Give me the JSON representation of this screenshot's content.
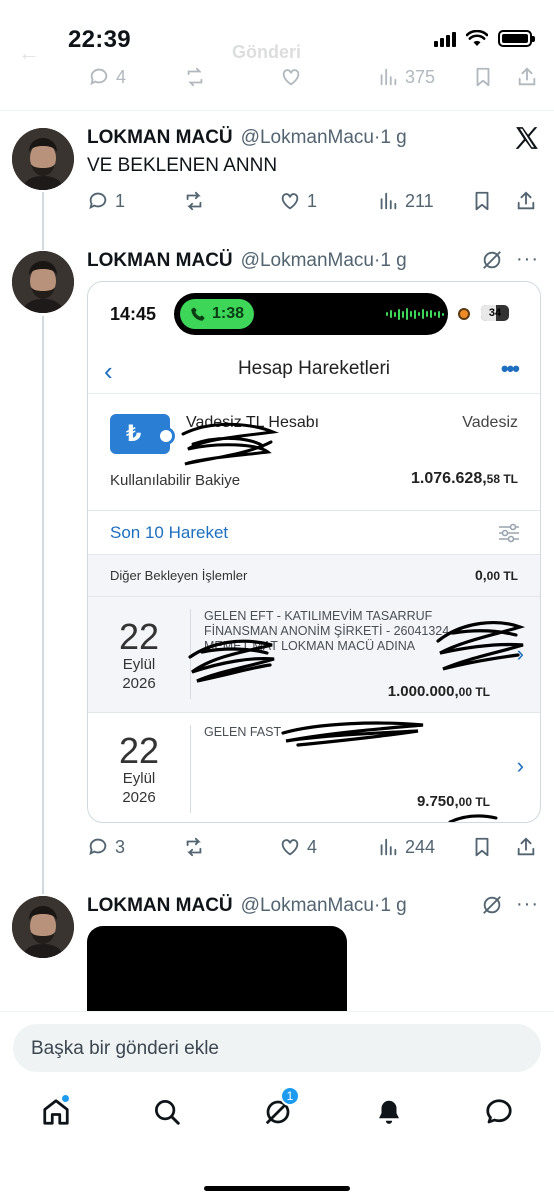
{
  "status_bar": {
    "time": "22:39"
  },
  "header": {
    "title": "Gönderi"
  },
  "top_row": {
    "replies": "4",
    "views": "375"
  },
  "tweets": [
    {
      "name": "LOKMAN MACÜ",
      "handle": "@LokmanMacu",
      "time": "1 g",
      "text": "VE BEKLENEN ANNN",
      "replies": "1",
      "likes": "1",
      "views": "211"
    },
    {
      "name": "LOKMAN MACÜ",
      "handle": "@LokmanMacu",
      "time": "1 g",
      "replies": "3",
      "likes": "4",
      "views": "244"
    },
    {
      "name": "LOKMAN MACÜ",
      "handle": "@LokmanMacu",
      "time": "1 g"
    }
  ],
  "bank": {
    "phone_time": "14:45",
    "call_timer": "1:38",
    "battery": "34",
    "title": "Hesap Hareketleri",
    "account_icon": "₺",
    "account_name": "Vadesiz TL Hesabı",
    "account_type": "Vadesiz",
    "balance_label": "Kullanılabilir Bakiye",
    "balance_main": "1.076.628,",
    "balance_cents": "58 TL",
    "last10_label": "Son 10 Hareket",
    "pending_label": "Diğer Bekleyen İşlemler",
    "pending_main": "0,",
    "pending_cents": "00 TL",
    "transactions": [
      {
        "day": "22",
        "month": "Eylül",
        "year": "2026",
        "line1": "GELEN EFT - KATILIMEVİM TASARRUF",
        "line2": "FİNANSMAN ANONİM ŞİRKETİ - 26041324",
        "line3": "MEMET MAT LOKMAN MACÜ ADINA",
        "amount_main": "1.000.000,",
        "amount_cents": "00 TL"
      },
      {
        "day": "22",
        "month": "Eylül",
        "year": "2026",
        "line1": "GELEN FAST",
        "amount_main": "9.750,",
        "amount_cents": "00 TL"
      }
    ]
  },
  "composer": {
    "placeholder": "Başka bir gönderi ekle"
  },
  "tabbar": {
    "notification_badge": "1"
  },
  "colors": {
    "accent": "#1d9bf0",
    "bank_blue": "#1e6fbf",
    "call_green": "#3dd659"
  }
}
